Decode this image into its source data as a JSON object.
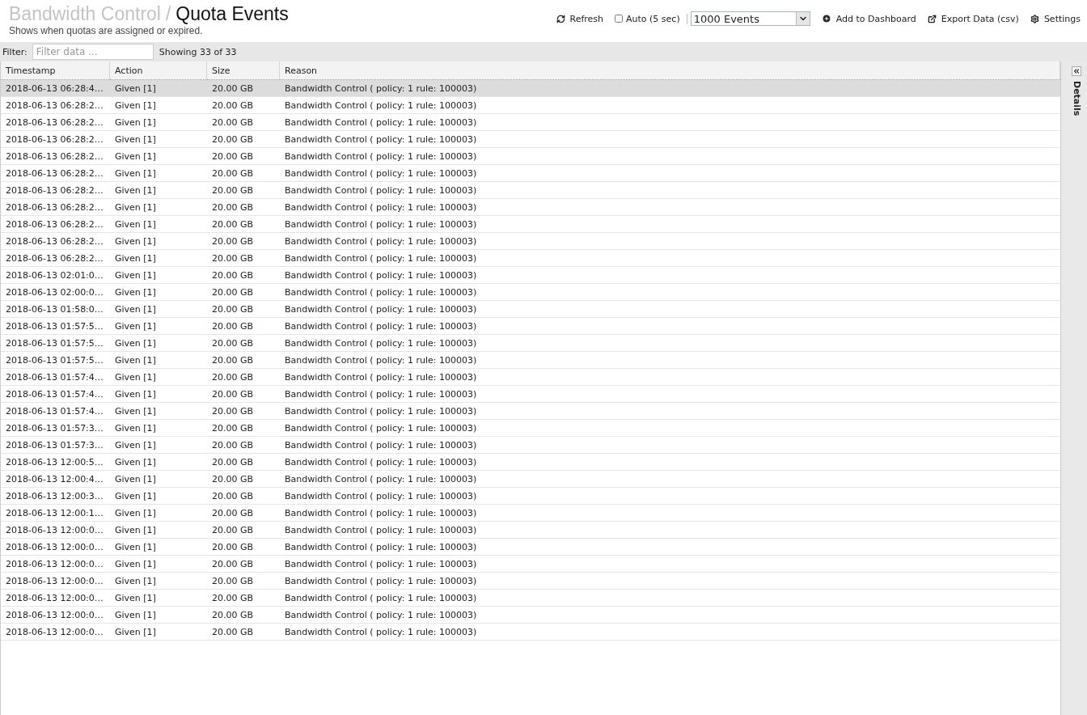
{
  "header": {
    "breadcrumb_parent": "Bandwidth Control",
    "separator": "/",
    "title": "Quota Events",
    "subtitle": "Shows when quotas are assigned or expired."
  },
  "toolbar": {
    "refresh": "Refresh",
    "auto": {
      "label": "Auto (5 sec)",
      "checked": false
    },
    "events_select": "1000 Events",
    "add_dashboard": "Add to Dashboard",
    "export": "Export Data (csv)",
    "settings": "Settings"
  },
  "filter": {
    "label": "Filter:",
    "placeholder": "Filter data ...",
    "count": "Showing 33 of 33"
  },
  "table": {
    "columns": [
      "Timestamp",
      "Action",
      "Size",
      "Reason"
    ],
    "rows": [
      {
        "timestamp": "2018-06-13 06:28:4…",
        "action": "Given [1]",
        "size": "20.00 GB",
        "reason": "Bandwidth Control ( policy: 1 rule: 100003)",
        "selected": true
      },
      {
        "timestamp": "2018-06-13 06:28:2…",
        "action": "Given [1]",
        "size": "20.00 GB",
        "reason": "Bandwidth Control ( policy: 1 rule: 100003)",
        "selected": false
      },
      {
        "timestamp": "2018-06-13 06:28:2…",
        "action": "Given [1]",
        "size": "20.00 GB",
        "reason": "Bandwidth Control ( policy: 1 rule: 100003)",
        "selected": false
      },
      {
        "timestamp": "2018-06-13 06:28:2…",
        "action": "Given [1]",
        "size": "20.00 GB",
        "reason": "Bandwidth Control ( policy: 1 rule: 100003)",
        "selected": false
      },
      {
        "timestamp": "2018-06-13 06:28:2…",
        "action": "Given [1]",
        "size": "20.00 GB",
        "reason": "Bandwidth Control ( policy: 1 rule: 100003)",
        "selected": false
      },
      {
        "timestamp": "2018-06-13 06:28:2…",
        "action": "Given [1]",
        "size": "20.00 GB",
        "reason": "Bandwidth Control ( policy: 1 rule: 100003)",
        "selected": false
      },
      {
        "timestamp": "2018-06-13 06:28:2…",
        "action": "Given [1]",
        "size": "20.00 GB",
        "reason": "Bandwidth Control ( policy: 1 rule: 100003)",
        "selected": false
      },
      {
        "timestamp": "2018-06-13 06:28:2…",
        "action": "Given [1]",
        "size": "20.00 GB",
        "reason": "Bandwidth Control ( policy: 1 rule: 100003)",
        "selected": false
      },
      {
        "timestamp": "2018-06-13 06:28:2…",
        "action": "Given [1]",
        "size": "20.00 GB",
        "reason": "Bandwidth Control ( policy: 1 rule: 100003)",
        "selected": false
      },
      {
        "timestamp": "2018-06-13 06:28:2…",
        "action": "Given [1]",
        "size": "20.00 GB",
        "reason": "Bandwidth Control ( policy: 1 rule: 100003)",
        "selected": false
      },
      {
        "timestamp": "2018-06-13 06:28:2…",
        "action": "Given [1]",
        "size": "20.00 GB",
        "reason": "Bandwidth Control ( policy: 1 rule: 100003)",
        "selected": false
      },
      {
        "timestamp": "2018-06-13 02:01:0…",
        "action": "Given [1]",
        "size": "20.00 GB",
        "reason": "Bandwidth Control ( policy: 1 rule: 100003)",
        "selected": false
      },
      {
        "timestamp": "2018-06-13 02:00:0…",
        "action": "Given [1]",
        "size": "20.00 GB",
        "reason": "Bandwidth Control ( policy: 1 rule: 100003)",
        "selected": false
      },
      {
        "timestamp": "2018-06-13 01:58:0…",
        "action": "Given [1]",
        "size": "20.00 GB",
        "reason": "Bandwidth Control ( policy: 1 rule: 100003)",
        "selected": false
      },
      {
        "timestamp": "2018-06-13 01:57:5…",
        "action": "Given [1]",
        "size": "20.00 GB",
        "reason": "Bandwidth Control ( policy: 1 rule: 100003)",
        "selected": false
      },
      {
        "timestamp": "2018-06-13 01:57:5…",
        "action": "Given [1]",
        "size": "20.00 GB",
        "reason": "Bandwidth Control ( policy: 1 rule: 100003)",
        "selected": false
      },
      {
        "timestamp": "2018-06-13 01:57:5…",
        "action": "Given [1]",
        "size": "20.00 GB",
        "reason": "Bandwidth Control ( policy: 1 rule: 100003)",
        "selected": false
      },
      {
        "timestamp": "2018-06-13 01:57:4…",
        "action": "Given [1]",
        "size": "20.00 GB",
        "reason": "Bandwidth Control ( policy: 1 rule: 100003)",
        "selected": false
      },
      {
        "timestamp": "2018-06-13 01:57:4…",
        "action": "Given [1]",
        "size": "20.00 GB",
        "reason": "Bandwidth Control ( policy: 1 rule: 100003)",
        "selected": false
      },
      {
        "timestamp": "2018-06-13 01:57:4…",
        "action": "Given [1]",
        "size": "20.00 GB",
        "reason": "Bandwidth Control ( policy: 1 rule: 100003)",
        "selected": false
      },
      {
        "timestamp": "2018-06-13 01:57:3…",
        "action": "Given [1]",
        "size": "20.00 GB",
        "reason": "Bandwidth Control ( policy: 1 rule: 100003)",
        "selected": false
      },
      {
        "timestamp": "2018-06-13 01:57:3…",
        "action": "Given [1]",
        "size": "20.00 GB",
        "reason": "Bandwidth Control ( policy: 1 rule: 100003)",
        "selected": false
      },
      {
        "timestamp": "2018-06-13 12:00:5…",
        "action": "Given [1]",
        "size": "20.00 GB",
        "reason": "Bandwidth Control ( policy: 1 rule: 100003)",
        "selected": false
      },
      {
        "timestamp": "2018-06-13 12:00:4…",
        "action": "Given [1]",
        "size": "20.00 GB",
        "reason": "Bandwidth Control ( policy: 1 rule: 100003)",
        "selected": false
      },
      {
        "timestamp": "2018-06-13 12:00:3…",
        "action": "Given [1]",
        "size": "20.00 GB",
        "reason": "Bandwidth Control ( policy: 1 rule: 100003)",
        "selected": false
      },
      {
        "timestamp": "2018-06-13 12:00:1…",
        "action": "Given [1]",
        "size": "20.00 GB",
        "reason": "Bandwidth Control ( policy: 1 rule: 100003)",
        "selected": false
      },
      {
        "timestamp": "2018-06-13 12:00:0…",
        "action": "Given [1]",
        "size": "20.00 GB",
        "reason": "Bandwidth Control ( policy: 1 rule: 100003)",
        "selected": false
      },
      {
        "timestamp": "2018-06-13 12:00:0…",
        "action": "Given [1]",
        "size": "20.00 GB",
        "reason": "Bandwidth Control ( policy: 1 rule: 100003)",
        "selected": false
      },
      {
        "timestamp": "2018-06-13 12:00:0…",
        "action": "Given [1]",
        "size": "20.00 GB",
        "reason": "Bandwidth Control ( policy: 1 rule: 100003)",
        "selected": false
      },
      {
        "timestamp": "2018-06-13 12:00:0…",
        "action": "Given [1]",
        "size": "20.00 GB",
        "reason": "Bandwidth Control ( policy: 1 rule: 100003)",
        "selected": false
      },
      {
        "timestamp": "2018-06-13 12:00:0…",
        "action": "Given [1]",
        "size": "20.00 GB",
        "reason": "Bandwidth Control ( policy: 1 rule: 100003)",
        "selected": false
      },
      {
        "timestamp": "2018-06-13 12:00:0…",
        "action": "Given [1]",
        "size": "20.00 GB",
        "reason": "Bandwidth Control ( policy: 1 rule: 100003)",
        "selected": false
      },
      {
        "timestamp": "2018-06-13 12:00:0…",
        "action": "Given [1]",
        "size": "20.00 GB",
        "reason": "Bandwidth Control ( policy: 1 rule: 100003)",
        "selected": false
      }
    ]
  },
  "details_panel": {
    "label": "Details"
  }
}
